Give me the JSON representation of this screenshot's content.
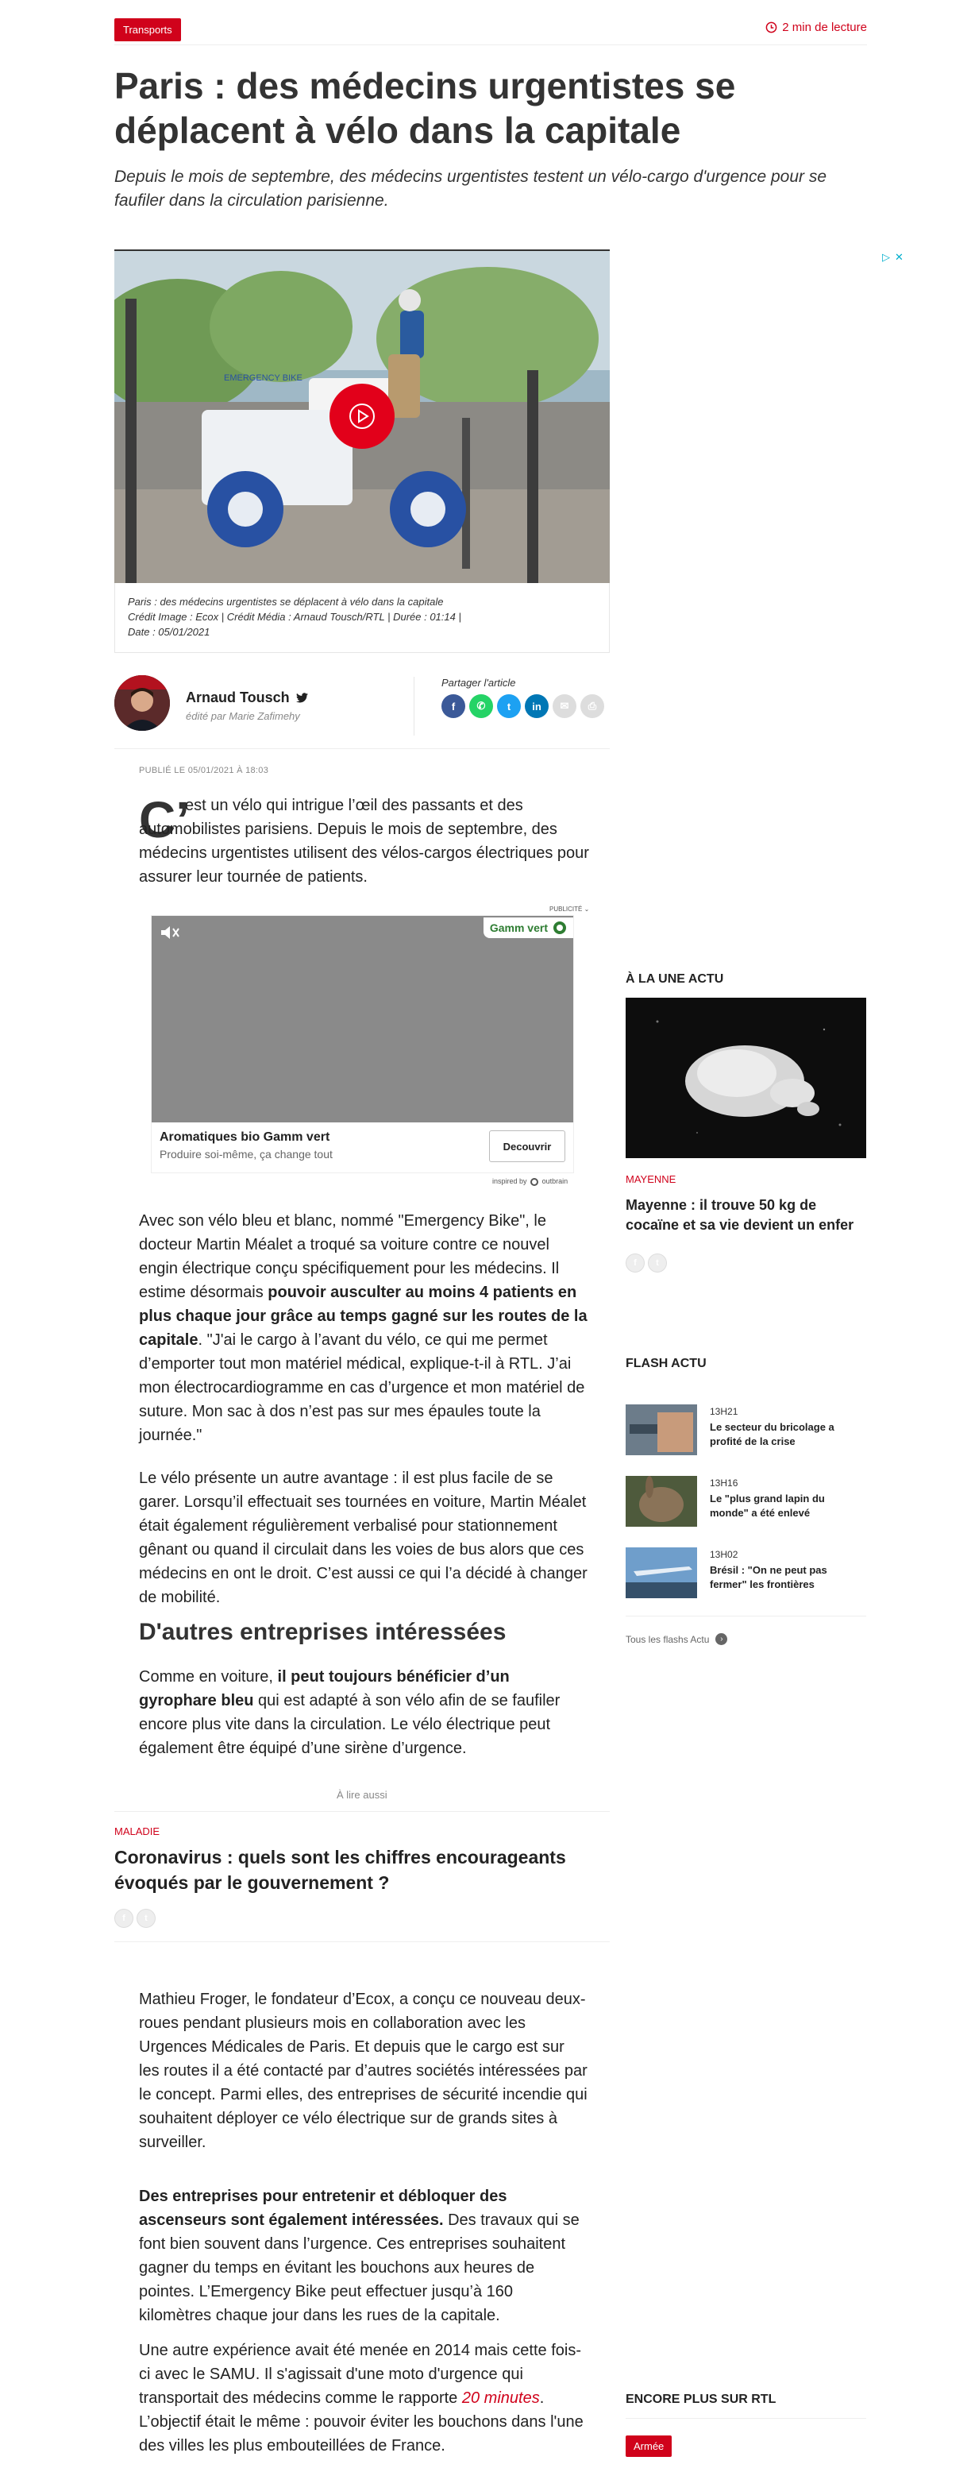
{
  "header": {
    "category_tag": "Transports",
    "read_time": "2 min de lecture"
  },
  "article": {
    "title": "Paris : des médecins urgentistes se déplacent à vélo dans la capitale",
    "chapo": "Depuis le mois de septembre, des médecins urgentistes testent un vélo-cargo d'urgence pour se faufiler dans la circulation parisienne.",
    "video_caption": {
      "line1": "Paris : des médecins urgentistes se déplacent à vélo dans la capitale",
      "line2": "Crédit Image : Ecox | Crédit Média : Arnaud Tousch/RTL | Durée : 01:14 |",
      "line3": "Date : 05/01/2021"
    },
    "bike_logo_text": "EMERGENCY BIKE",
    "author": {
      "name": "Arnaud Tousch",
      "edited_by": "édité par Marie Zafimehy"
    },
    "share_label": "Partager l'article",
    "published": "PUBLIÉ LE 05/01/2021 À 18:03",
    "dropcap": "C’",
    "lead": "est un vélo qui intrigue l’œil des passants et des automobilistes parisiens. Depuis le mois de septembre, des médecins urgentistes utilisent des vélos-cargos électriques pour assurer leur tournée de patients.",
    "p1_a": "Avec son vélo bleu et blanc, nommé \"Emergency Bike\", le docteur Martin Méalet a troqué sa voiture contre ce nouvel engin électrique conçu spécifiquement pour les médecins. Il estime désormais ",
    "p1_b": "pouvoir ausculter au moins 4 patients en plus chaque jour grâce au temps gagné sur les routes de la capitale",
    "p1_c": ". \"J'ai le cargo à l’avant du vélo, ce qui me permet d’emporter tout mon matériel médical, explique-t-il à RTL. J’ai mon électrocardiogramme en cas d’urgence et mon matériel de suture. Mon sac à dos n’est pas sur mes épaules toute la journée.\"",
    "p2": "Le vélo présente un autre avantage : il est plus facile de se garer. Lorsqu’il effectuait ses tournées en voiture, Martin Méalet était également régulièrement verbalisé pour stationnement gênant ou quand il circulait dans les voies de bus alors que ces médecins en ont le droit. C’est aussi ce qui l’a décidé à changer de mobilité.",
    "h2": "D'autres entreprises intéressées",
    "p3_a": "Comme en voiture, ",
    "p3_b": "il peut toujours bénéficier d’un gyrophare bleu",
    "p3_c": " qui est adapté à son vélo afin de se faufiler encore plus vite dans la circulation. Le vélo électrique peut également être équipé d’une sirène d’urgence.",
    "p4": "Mathieu Froger, le fondateur d’Ecox, a conçu ce nouveau deux-roues pendant plusieurs mois en collaboration avec les Urgences Médicales de Paris. Et depuis que le cargo est sur les routes il a été contacté par d’autres sociétés intéressées par le concept. Parmi elles, des entreprises de sécurité incendie qui souhaitent déployer ce vélo électrique sur de grands sites à surveiller.",
    "p5_a": "Des entreprises pour entretenir et débloquer des ascenseurs sont également intéressées.",
    "p5_b": " Des travaux qui se font bien souvent dans l’urgence. Ces entreprises souhaitent gagner du temps en évitant les bouchons aux heures de pointes. L’Emergency Bike peut effectuer jusqu’à 160 kilomètres chaque jour dans les rues de la capitale.",
    "p6_a": "Une autre expérience avait été menée en 2014 mais cette fois-ci avec le SAMU. Il s'agissait d'une moto d'urgence qui transportait des médecins comme le rapporte ",
    "p6_link": "20 minutes",
    "p6_b": ". L’objectif était le même : pouvoir éviter les bouchons dans l'une des villes les plus embouteillées de France."
  },
  "ad": {
    "label": "PUBLICITÉ",
    "brand": "Gamm vert",
    "title": "Aromatiques bio Gamm vert",
    "subtitle": "Produire soi-même, ça change tout",
    "cta": "Decouvrir",
    "inspired_by": "inspired by",
    "network": "outbrain"
  },
  "related": {
    "label": "À lire aussi",
    "category": "MALADIE",
    "title": "Coronavirus : quels sont les chiffres encourageants évoqués par le gouvernement ?"
  },
  "sidebar": {
    "une_title": "À LA UNE ACTU",
    "une_category": "MAYENNE",
    "une_headline": "Mayenne : il trouve 50 kg de cocaïne et sa vie devient un enfer",
    "flash_title": "FLASH ACTU",
    "flash": [
      {
        "time": "13H21",
        "title": "Le secteur du bricolage a profité de la crise"
      },
      {
        "time": "13H16",
        "title": "Le \"plus grand lapin du monde\" a été enlevé"
      },
      {
        "time": "13H02",
        "title": "Brésil : \"On ne peut pas fermer\" les frontières"
      }
    ],
    "all_flash": "Tous les flashs Actu",
    "more_title": "ENCORE PLUS SUR RTL",
    "more_tag": "Armée"
  },
  "colors": {
    "accent": "#d0021b",
    "facebook": "#3b5998",
    "whatsapp": "#25d366",
    "twitter": "#1da1f2",
    "linkedin": "#0077b5"
  }
}
